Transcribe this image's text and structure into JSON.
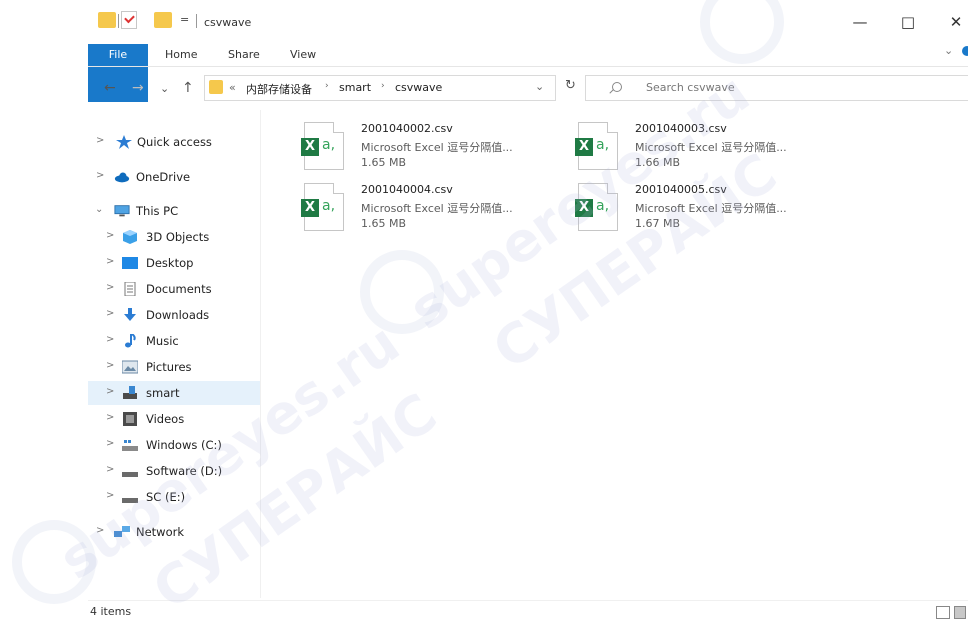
{
  "titlebar": {
    "title": "csvwave",
    "qat_glyph": "=",
    "controls": {
      "minimize": "—",
      "maximize": "□",
      "close": "✕"
    }
  },
  "ribbon": {
    "tabs": [
      {
        "label": "File",
        "active": true
      },
      {
        "label": "Home"
      },
      {
        "label": "Share"
      },
      {
        "label": "View"
      }
    ],
    "expand_glyph": "⌄"
  },
  "address": {
    "back": "←",
    "forward": "→",
    "recent": "⌄",
    "up": "↑",
    "prefix": "«",
    "crumbs": [
      "内部存储设备",
      "smart",
      "csvwave"
    ],
    "separator": "›",
    "dropdown": "⌄",
    "refresh": "↻"
  },
  "search": {
    "placeholder": "Search csvwave"
  },
  "sidebar": {
    "items": [
      {
        "label": "Quick access",
        "chevron": ">",
        "icon": "star-icon"
      },
      {
        "label": "OneDrive",
        "chevron": ">",
        "icon": "cloud-icon"
      },
      {
        "label": "This PC",
        "chevron": "⌄",
        "icon": "computer-icon"
      },
      {
        "label": "3D Objects",
        "chevron": ">",
        "icon": "cube-icon"
      },
      {
        "label": "Desktop",
        "chevron": ">",
        "icon": "desktop-icon"
      },
      {
        "label": "Documents",
        "chevron": ">",
        "icon": "document-icon"
      },
      {
        "label": "Downloads",
        "chevron": ">",
        "icon": "download-icon"
      },
      {
        "label": "Music",
        "chevron": ">",
        "icon": "music-icon"
      },
      {
        "label": "Pictures",
        "chevron": ">",
        "icon": "picture-icon"
      },
      {
        "label": "smart",
        "chevron": ">",
        "icon": "device-icon",
        "selected": true
      },
      {
        "label": "Videos",
        "chevron": ">",
        "icon": "video-icon"
      },
      {
        "label": "Windows (C:)",
        "chevron": ">",
        "icon": "drive-icon"
      },
      {
        "label": "Software (D:)",
        "chevron": ">",
        "icon": "drive-icon"
      },
      {
        "label": "SC (E:)",
        "chevron": ">",
        "icon": "drive-icon"
      },
      {
        "label": "Network",
        "chevron": ">",
        "icon": "network-icon"
      }
    ]
  },
  "files": [
    {
      "name": "2001040002.csv",
      "type": "Microsoft Excel 逗号分隔值...",
      "size": "1.65 MB",
      "icon_letter": "X",
      "icon_suffix": "a,"
    },
    {
      "name": "2001040003.csv",
      "type": "Microsoft Excel 逗号分隔值...",
      "size": "1.66 MB",
      "icon_letter": "X",
      "icon_suffix": "a,"
    },
    {
      "name": "2001040004.csv",
      "type": "Microsoft Excel 逗号分隔值...",
      "size": "1.65 MB",
      "icon_letter": "X",
      "icon_suffix": "a,"
    },
    {
      "name": "2001040005.csv",
      "type": "Microsoft Excel 逗号分隔值...",
      "size": "1.67 MB",
      "icon_letter": "X",
      "icon_suffix": "a,"
    }
  ],
  "statusbar": {
    "count": "4 items"
  },
  "colors": {
    "accent": "#1979ca",
    "excel": "#1f7a44",
    "selection": "#e5f1fb",
    "folder": "#f5c84c"
  },
  "watermark": {
    "text1": "supereyes.ru",
    "text2": "СУПЕРАЙС"
  }
}
